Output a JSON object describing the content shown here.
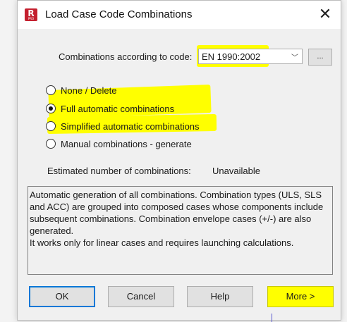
{
  "window": {
    "title": "Load Case Code Combinations",
    "icon_letter": "R",
    "icon_sub": "PRO",
    "close_glyph": "✕"
  },
  "code": {
    "label": "Combinations according to code:",
    "selected": "EN 1990:2002",
    "chevron": "﹀",
    "browse_label": "..."
  },
  "radios": [
    {
      "label": "None / Delete",
      "checked": false
    },
    {
      "label": "Full automatic combinations",
      "checked": true
    },
    {
      "label": "Simplified automatic combinations",
      "checked": false
    },
    {
      "label": "Manual combinations - generate",
      "checked": false
    }
  ],
  "estimate": {
    "label": "Estimated number of combinations:",
    "value": "Unavailable"
  },
  "description": {
    "para1": "Automatic generation of all combinations. Combination types (ULS, SLS and ACC) are grouped into composed cases whose components include subsequent combinations. Combination envelope cases (+/-) are also generated.",
    "para2": "It works only for linear cases and requires launching calculations."
  },
  "buttons": {
    "ok": "OK",
    "cancel": "Cancel",
    "help": "Help",
    "more": "More >"
  },
  "colors": {
    "highlight": "#ffff00",
    "accent": "#0078d7",
    "icon_red": "#c4202f"
  }
}
